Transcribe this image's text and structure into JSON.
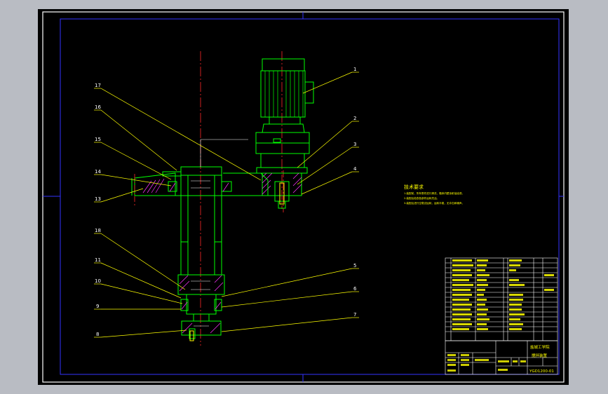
{
  "colors": {
    "background": "#000000",
    "frame": "#ffffff",
    "border": "#3333ff",
    "part_outline": "#00ff00",
    "centerline": "#ff2a2a",
    "leader": "#ffff00",
    "hatch": "#ff33ff",
    "dimension": "#ffffff"
  },
  "balloons": [
    "1",
    "2",
    "3",
    "4",
    "5",
    "6",
    "7",
    "8",
    "9",
    "10",
    "11",
    "13",
    "14",
    "15",
    "16",
    "17",
    "18"
  ],
  "notes": {
    "title": "技术要求",
    "items": [
      "1.装配前，所有零件进行清洗，箱体内壁涂耐油油漆。",
      "2.装配后检查各部件运转灵活。",
      "3.装配后进行空载试运转，运转平稳，无冲击和噪声。"
    ]
  },
  "title_block": {
    "company": "盐城工学院",
    "drawing_name": "搅拌装置",
    "drawing_number": "YGD1200-01"
  }
}
